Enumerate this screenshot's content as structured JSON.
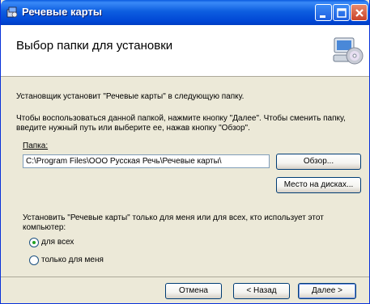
{
  "window": {
    "title": "Речевые карты",
    "app_icon": "installer-package-icon",
    "controls": {
      "minimize": "minimize-icon",
      "maximize": "maximize-icon",
      "close": "close-icon"
    }
  },
  "header": {
    "title": "Выбор папки для установки",
    "icon": "computer-cd-icon"
  },
  "body": {
    "intro": "Установщик установит \"Речевые карты\" в следующую папку.",
    "instructions_line1": "Чтобы воспользоваться данной папкой, нажмите кнопку \"Далее\". Чтобы сменить папку,",
    "instructions_line2": "введите нужный путь или выберите ее, нажав кнопку \"Обзор\".",
    "folder_label": "Папка:",
    "folder_value": "C:\\Program Files\\ООО Русская Речь\\Речевые карты\\",
    "browse_label": "Обзор...",
    "disk_cost_label": "Место на дисках...",
    "install_for_line1": "Установить \"Речевые карты\" только для меня или для всех, кто использует этот",
    "install_for_line2": "компьютер:",
    "option_everyone": "для всех",
    "option_just_me": "только для меня",
    "selected_option": "everyone"
  },
  "footer": {
    "cancel_label": "Отмена",
    "back_label": "< Назад",
    "next_label": "Далее >"
  },
  "colors": {
    "titlebar": "#0046d5",
    "dialog_background": "#ece9d8",
    "close_button": "#c9432a",
    "radio_selected": "#21a121"
  }
}
